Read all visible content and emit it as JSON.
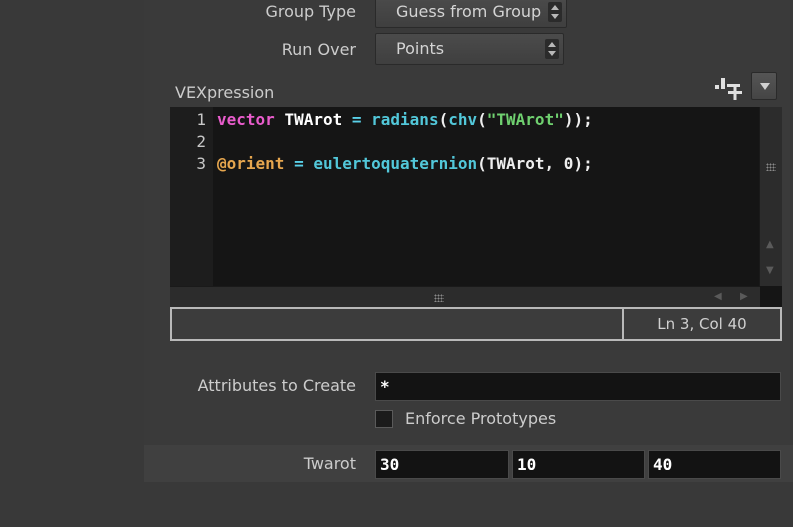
{
  "group_type": {
    "label": "Group Type",
    "value": "Guess from Group"
  },
  "run_over": {
    "label": "Run Over",
    "value": "Points"
  },
  "vexpression": {
    "label": "VEXpression",
    "lines": [
      {
        "num": "1",
        "tokens": [
          {
            "t": "vector",
            "c": "kw"
          },
          {
            "t": " ",
            "c": "pun"
          },
          {
            "t": "TWArot",
            "c": "var"
          },
          {
            "t": " = ",
            "c": "op"
          },
          {
            "t": "radians",
            "c": "fn"
          },
          {
            "t": "(",
            "c": "pun"
          },
          {
            "t": "chv",
            "c": "fn"
          },
          {
            "t": "(",
            "c": "pun"
          },
          {
            "t": "\"TWArot\"",
            "c": "str"
          },
          {
            "t": "));",
            "c": "pun"
          }
        ]
      },
      {
        "num": "2",
        "tokens": []
      },
      {
        "num": "3",
        "tokens": [
          {
            "t": "@orient",
            "c": "attr"
          },
          {
            "t": " = ",
            "c": "op"
          },
          {
            "t": "eulertoquaternion",
            "c": "fn"
          },
          {
            "t": "(TWArot, 0);",
            "c": "pun"
          }
        ]
      }
    ],
    "cursor_position": "Ln 3, Col 40"
  },
  "attributes_to_create": {
    "label": "Attributes to Create",
    "value": "*"
  },
  "enforce_prototypes": {
    "label": "Enforce Prototypes",
    "checked": false
  },
  "twarot": {
    "label": "Twarot",
    "values": [
      "30",
      "10",
      "40"
    ]
  },
  "icons": {
    "add_remove": "plus-minus-icon",
    "menu": "dropdown-arrow-icon"
  }
}
